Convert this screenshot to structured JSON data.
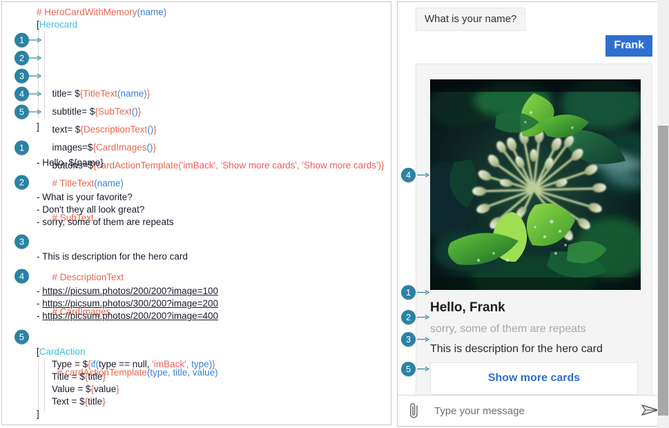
{
  "left_panel": {
    "name": "lg-template-code",
    "blocks": [
      {
        "id": "herocard-block",
        "header_prefix": "# ",
        "header_name": "HeroCardWithMemory",
        "header_args": "(name)",
        "open_bracket": "[",
        "open_name": "Herocard",
        "close_bracket": "]",
        "lines": [
          {
            "badge": "1",
            "key": "title= $",
            "tpl_open": "{",
            "tpl_name": "TitleText",
            "tpl_args": "(name)",
            "tpl_close": "}"
          },
          {
            "badge": "2",
            "key": "subtitle= $",
            "tpl_open": "{",
            "tpl_name": "SubText",
            "tpl_args": "()",
            "tpl_close": "}"
          },
          {
            "badge": "3",
            "key": "text= $",
            "tpl_open": "{",
            "tpl_name": "DescriptionText",
            "tpl_args": "()",
            "tpl_close": "}"
          },
          {
            "badge": "4",
            "key": "images=$",
            "tpl_open": "{",
            "tpl_name": "CardImages",
            "tpl_args": "()",
            "tpl_close": "}"
          },
          {
            "badge": "5",
            "key": "buttons=$",
            "tpl_open": "{",
            "tpl_name": "cardActionTemplate",
            "tpl_args": "(",
            "arg1": "'imBack'",
            "sep1": ", ",
            "arg2": "'Show more cards'",
            "sep2": ", ",
            "arg3": "'Show more cards'",
            "tpl_close": ")}"
          }
        ]
      },
      {
        "id": "titletext-block",
        "badge": "1",
        "header_prefix": "# ",
        "header_name": "TitleText",
        "header_args": "(name)",
        "items": [
          "- Hello, ${name}"
        ]
      },
      {
        "id": "subtext-block",
        "badge": "2",
        "header_prefix": "# ",
        "header_name": "SubText",
        "header_args": "",
        "items": [
          "- What is your favorite?",
          "- Don't they all look great?",
          "- sorry, some of them are repeats"
        ]
      },
      {
        "id": "descriptiontext-block",
        "badge": "3",
        "header_prefix": "# ",
        "header_name": "DescriptionText",
        "header_args": "",
        "items": [
          "- This is description for the hero card"
        ]
      },
      {
        "id": "cardimages-block",
        "badge": "4",
        "header_prefix": "# ",
        "header_name": "CardImages",
        "header_args": "",
        "links": [
          "https://picsum.photos/200/200?image=100",
          "https://picsum.photos/300/200?image=200",
          "https://picsum.photos/200/200?image=400"
        ]
      },
      {
        "id": "cardactiontemplate-block",
        "badge": "5",
        "header_prefix": "# ",
        "header_name": "cardActionTemplate",
        "header_args": "(type, title, value)",
        "open_bracket": "[",
        "open_name": "CardAction",
        "close_bracket": "]",
        "props": [
          {
            "key": "Type = $",
            "brace_open": "{",
            "fn": "if(",
            "mid": "type == null, ",
            "str": "'imBack'",
            "tail": ", type)",
            "brace_close": "}"
          },
          {
            "key": "Title = $",
            "brace_open": "{",
            "plain": "title",
            "brace_close": "}"
          },
          {
            "key": "Value = $",
            "brace_open": "{",
            "plain": "value",
            "brace_close": "}"
          },
          {
            "key": "Text = $",
            "brace_open": "{",
            "plain": "title",
            "brace_close": "}"
          }
        ]
      }
    ]
  },
  "chat": {
    "bot_message": "What is your name?",
    "user_message": "Frank",
    "card": {
      "image_alt": "green-leaves-flower-buds",
      "image_marker": "4",
      "title": "Hello, Frank",
      "title_marker": "1",
      "subtitle": "sorry, some of them are repeats",
      "subtitle_marker": "2",
      "text": "This is description for the hero card",
      "text_marker": "3",
      "button_label": "Show more cards",
      "button_marker": "5"
    },
    "composer": {
      "attach_icon": "paperclip-icon",
      "input_value": "",
      "input_placeholder": "Type your message",
      "send_icon": "send-icon"
    }
  },
  "colors": {
    "badge": "#2a82a4",
    "template_name": "#e8664c",
    "args": "#3a7fd5",
    "type_name": "#45bcdd",
    "string": "#ef5b5b",
    "user_bubble": "#2f6fd0",
    "card_button_text": "#2a6fc9"
  }
}
